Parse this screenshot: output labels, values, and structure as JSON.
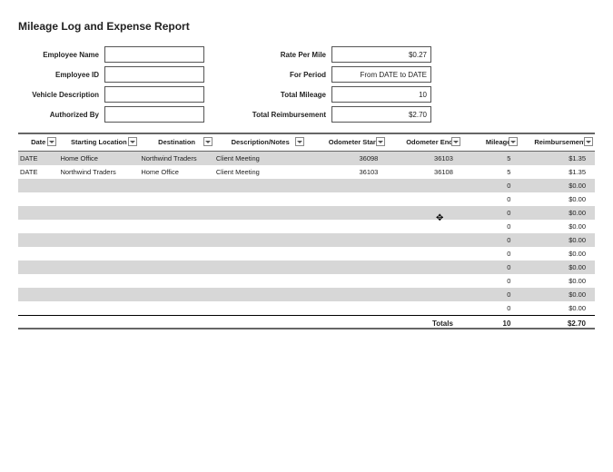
{
  "title": "Mileage Log and Expense Report",
  "form": {
    "left": {
      "employee_name_label": "Employee Name",
      "employee_name_value": "",
      "employee_id_label": "Employee ID",
      "employee_id_value": "",
      "vehicle_desc_label": "Vehicle Description",
      "vehicle_desc_value": "",
      "authorized_by_label": "Authorized By",
      "authorized_by_value": ""
    },
    "right": {
      "rate_label": "Rate Per Mile",
      "rate_value": "$0.27",
      "period_label": "For Period",
      "period_value": "From DATE to DATE",
      "total_mileage_label": "Total Mileage",
      "total_mileage_value": "10",
      "total_reimb_label": "Total Reimbursement",
      "total_reimb_value": "$2.70"
    }
  },
  "columns": {
    "date": "Date",
    "start": "Starting Location",
    "dest": "Destination",
    "desc": "Description/Notes",
    "ostart": "Odometer Start",
    "oend": "Odometer End",
    "miles": "Mileage",
    "reimb": "Reimbursement"
  },
  "rows": [
    {
      "date": "DATE",
      "start": "Home Office",
      "dest": "Northwind Traders",
      "desc": "Client Meeting",
      "ostart": "36098",
      "oend": "36103",
      "miles": "5",
      "reimb": "$1.35"
    },
    {
      "date": "DATE",
      "start": "Northwind Traders",
      "dest": "Home Office",
      "desc": "Client Meeting",
      "ostart": "36103",
      "oend": "36108",
      "miles": "5",
      "reimb": "$1.35"
    },
    {
      "date": "",
      "start": "",
      "dest": "",
      "desc": "",
      "ostart": "",
      "oend": "",
      "miles": "0",
      "reimb": "$0.00"
    },
    {
      "date": "",
      "start": "",
      "dest": "",
      "desc": "",
      "ostart": "",
      "oend": "",
      "miles": "0",
      "reimb": "$0.00"
    },
    {
      "date": "",
      "start": "",
      "dest": "",
      "desc": "",
      "ostart": "",
      "oend": "",
      "miles": "0",
      "reimb": "$0.00"
    },
    {
      "date": "",
      "start": "",
      "dest": "",
      "desc": "",
      "ostart": "",
      "oend": "",
      "miles": "0",
      "reimb": "$0.00"
    },
    {
      "date": "",
      "start": "",
      "dest": "",
      "desc": "",
      "ostart": "",
      "oend": "",
      "miles": "0",
      "reimb": "$0.00"
    },
    {
      "date": "",
      "start": "",
      "dest": "",
      "desc": "",
      "ostart": "",
      "oend": "",
      "miles": "0",
      "reimb": "$0.00"
    },
    {
      "date": "",
      "start": "",
      "dest": "",
      "desc": "",
      "ostart": "",
      "oend": "",
      "miles": "0",
      "reimb": "$0.00"
    },
    {
      "date": "",
      "start": "",
      "dest": "",
      "desc": "",
      "ostart": "",
      "oend": "",
      "miles": "0",
      "reimb": "$0.00"
    },
    {
      "date": "",
      "start": "",
      "dest": "",
      "desc": "",
      "ostart": "",
      "oend": "",
      "miles": "0",
      "reimb": "$0.00"
    },
    {
      "date": "",
      "start": "",
      "dest": "",
      "desc": "",
      "ostart": "",
      "oend": "",
      "miles": "0",
      "reimb": "$0.00"
    }
  ],
  "totals": {
    "label": "Totals",
    "miles": "10",
    "reimb": "$2.70"
  }
}
